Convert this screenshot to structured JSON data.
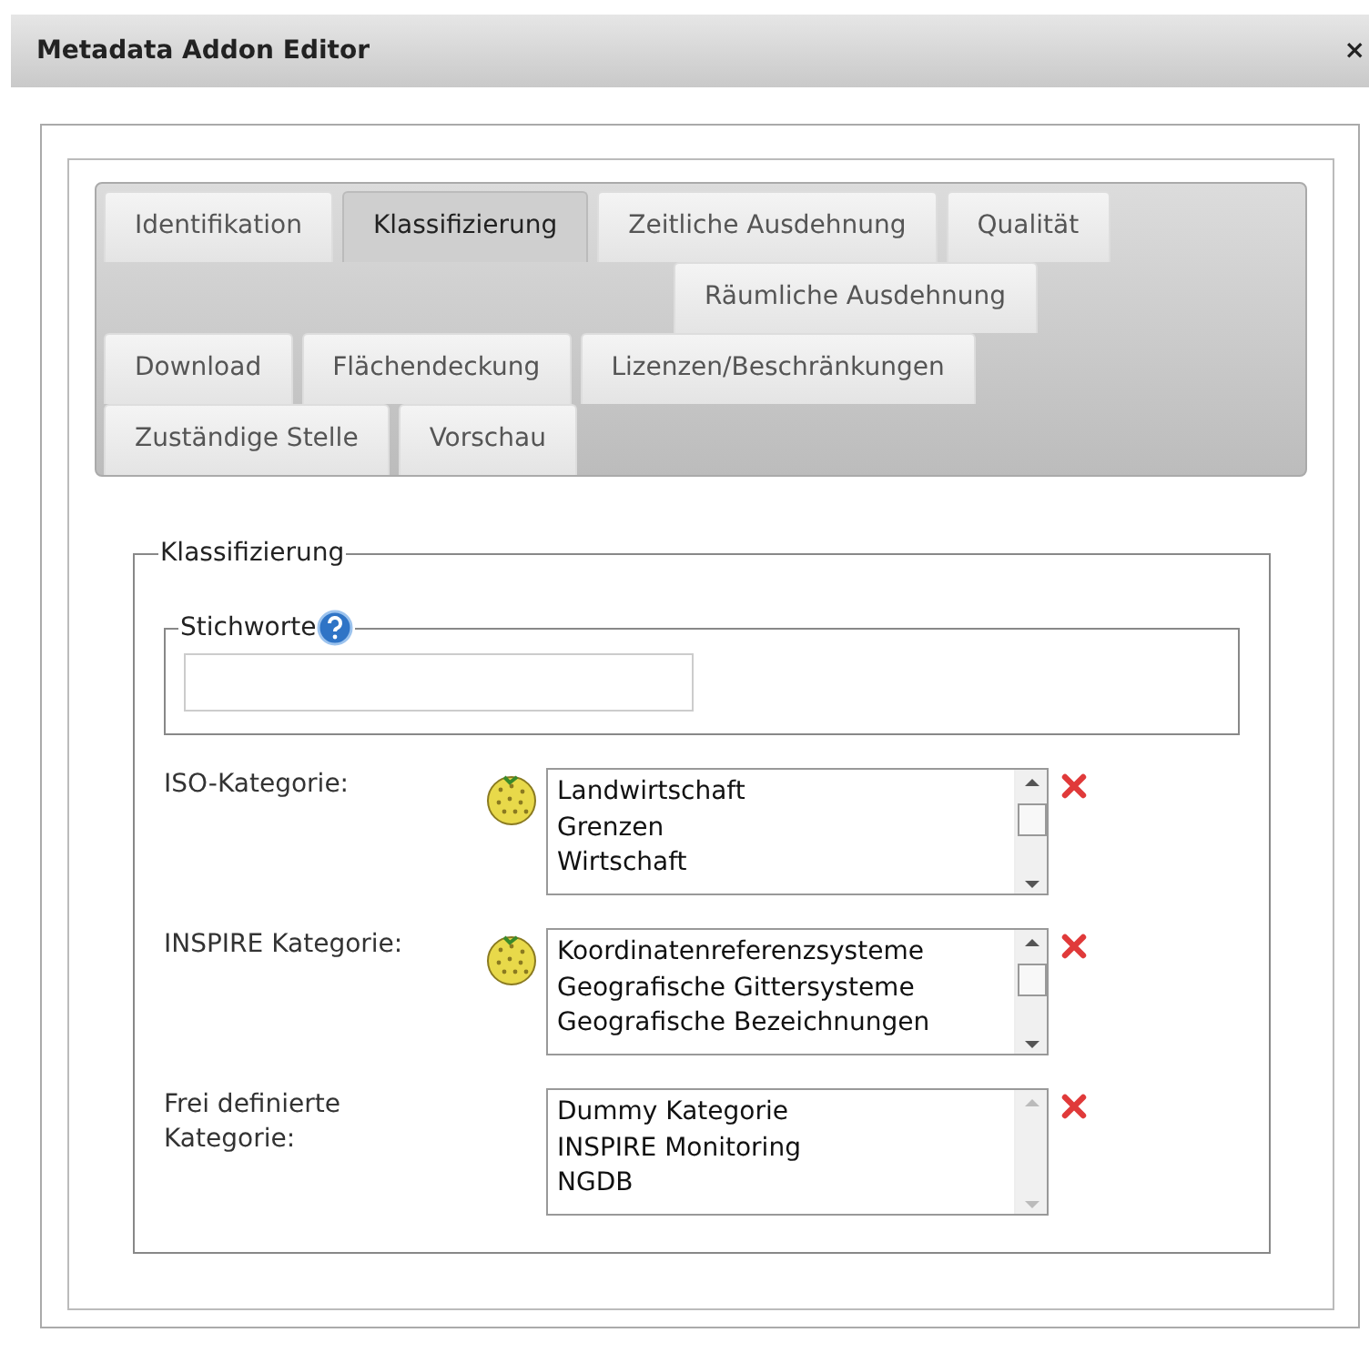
{
  "window": {
    "title": "Metadata Addon Editor",
    "close": "×"
  },
  "tab_rows": [
    [
      {
        "label": "Identifikation",
        "selected": false
      },
      {
        "label": "Klassifizierung",
        "selected": true
      },
      {
        "label": "Zeitliche Ausdehnung",
        "selected": false
      },
      {
        "label": "Qualität",
        "selected": false
      }
    ],
    [
      {
        "label": "Räumliche Ausdehnung",
        "selected": false
      }
    ],
    [
      {
        "label": "Download",
        "selected": false
      },
      {
        "label": "Flächendeckung",
        "selected": false
      },
      {
        "label": "Lizenzen/Beschränkungen",
        "selected": false
      }
    ],
    [
      {
        "label": "Zuständige Stelle",
        "selected": false
      },
      {
        "label": "Vorschau",
        "selected": false
      }
    ]
  ],
  "section": {
    "legend": "Klassifizierung",
    "keywords": {
      "legend": "Stichworte"
    },
    "categories": [
      {
        "label": "ISO-Kategorie:",
        "globe": true,
        "options": [
          "Landwirtschaft",
          "Grenzen",
          "Wirtschaft"
        ],
        "scrollable": true
      },
      {
        "label": "INSPIRE Kategorie:",
        "globe": true,
        "options": [
          "Koordinatenreferenzsysteme",
          "Geografische Gittersysteme",
          "Geografische Bezeichnungen"
        ],
        "scrollable": true
      },
      {
        "label": "Frei definierte Kategorie:",
        "globe": false,
        "options": [
          "Dummy Kategorie",
          "INSPIRE Monitoring",
          "NGDB"
        ],
        "scrollable": false
      }
    ]
  }
}
